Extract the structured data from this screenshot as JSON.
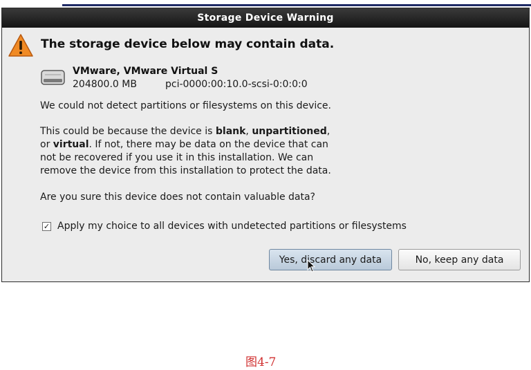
{
  "dialog": {
    "title": "Storage Device Warning",
    "heading": "The storage device below may contain data.",
    "warning_icon": "warning-triangle-icon",
    "device": {
      "icon": "hard-disk-icon",
      "name": "VMware, VMware Virtual S",
      "size": "204800.0 MB",
      "path": "pci-0000:00:10.0-scsi-0:0:0:0"
    },
    "paragraph1": "We could not detect partitions or filesystems on this device.",
    "paragraph2": {
      "part1": "This could be because the device is ",
      "bold1": "blank",
      "sep1": ", ",
      "bold2": "unpartitioned",
      "sep2": ",",
      "part2": "or ",
      "bold3": "virtual",
      "part3": ". If not, there may be data on the device that can",
      "line3": "not be recovered if you use it in this installation. We can",
      "line4": "remove the device from this installation to protect the data."
    },
    "question": "Are you sure this device does not contain valuable data?",
    "apply_all": {
      "checked": true,
      "label": "Apply my choice to all devices with undetected partitions or filesystems"
    },
    "buttons": {
      "yes": "Yes, discard any data",
      "no": "No, keep any data"
    }
  },
  "caption": "图4-7",
  "colors": {
    "titlebar": "#1e1e1e",
    "dialog_bg": "#ececec",
    "default_button": "#c8d6e4",
    "caption": "#d03030"
  }
}
